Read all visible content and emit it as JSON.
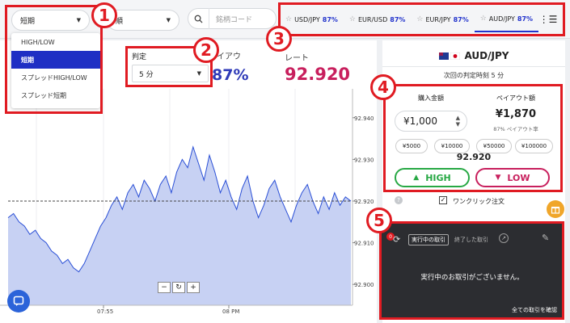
{
  "top": {
    "type_select": "短期",
    "second_select": "順",
    "search_placeholder": "銘柄コード"
  },
  "type_menu": [
    "HIGH/LOW",
    "短期",
    "スプレッドHIGH/LOW",
    "スプレッド短期"
  ],
  "pairs": [
    {
      "name": "USD/JPY",
      "payout": "87%"
    },
    {
      "name": "EUR/USD",
      "payout": "87%"
    },
    {
      "name": "EUR/JPY",
      "payout": "87%"
    },
    {
      "name": "AUD/JPY",
      "payout": "87%"
    }
  ],
  "callouts": [
    "1",
    "2",
    "3",
    "4",
    "5"
  ],
  "info": {
    "judge_label": "判定",
    "judge_value": "5 分",
    "payout_label": "イアウ",
    "payout_value": "87%",
    "rate_label": "レート",
    "rate_value": "92.920"
  },
  "chart": {
    "y_ticks": [
      "92.940",
      "92.930",
      "92.920",
      "92.910",
      "92.900"
    ],
    "x_ticks": [
      "07:55",
      "08 PM"
    ],
    "reference_level": 92.92,
    "line_color": "#2a4fd6",
    "fill_color": "#c7d1f3"
  },
  "chart_data": {
    "type": "area",
    "title": "",
    "xlabel": "",
    "ylabel": "",
    "ylim": [
      92.895,
      92.945
    ],
    "x_ticks": [
      "07:55",
      "08 PM"
    ],
    "series": [
      {
        "values": [
          92.916,
          92.917,
          92.915,
          92.914,
          92.912,
          92.913,
          92.911,
          92.91,
          92.908,
          92.907,
          92.905,
          92.906,
          92.904,
          92.903,
          92.905,
          92.908,
          92.911,
          92.914,
          92.916,
          92.919,
          92.921,
          92.918,
          92.922,
          92.924,
          92.921,
          92.925,
          92.923,
          92.92,
          92.924,
          92.926,
          92.922,
          92.927,
          92.93,
          92.928,
          92.933,
          92.929,
          92.925,
          92.931,
          92.927,
          92.922,
          92.925,
          92.921,
          92.918,
          92.923,
          92.926,
          92.92,
          92.916,
          92.919,
          92.923,
          92.925,
          92.921,
          92.918,
          92.915,
          92.919,
          92.922,
          92.924,
          92.92,
          92.917,
          92.921,
          92.918,
          92.922,
          92.919,
          92.921,
          92.92
        ]
      }
    ]
  },
  "chart_tools": [
    "−",
    "↻",
    "+"
  ],
  "trade": {
    "pair": "AUD/JPY",
    "next_judge": "次回の判定時刻 5 分",
    "amount_label": "購入金額",
    "amount_value": "¥1,000",
    "payout_label": "ペイアウト額",
    "payout_amount": "¥1,870",
    "payout_rate": "87% ペイアウト率",
    "quick_amounts": [
      "¥5000",
      "¥10000",
      "¥50000",
      "¥100000"
    ],
    "rate": "92.920",
    "high": "HIGH",
    "low": "LOW",
    "one_click": "ワンクリック注文"
  },
  "history": {
    "badge": "0",
    "tab_active": "実行中の取引",
    "tab_other": "終了した取引",
    "empty": "実行中のお取引がございません。",
    "all_link": "全ての取引を確認"
  },
  "colors": {
    "accent": "#1f2fc4",
    "callout_red": "#e01b22",
    "high_green": "#27a844",
    "low_pink": "#c81f5d"
  }
}
